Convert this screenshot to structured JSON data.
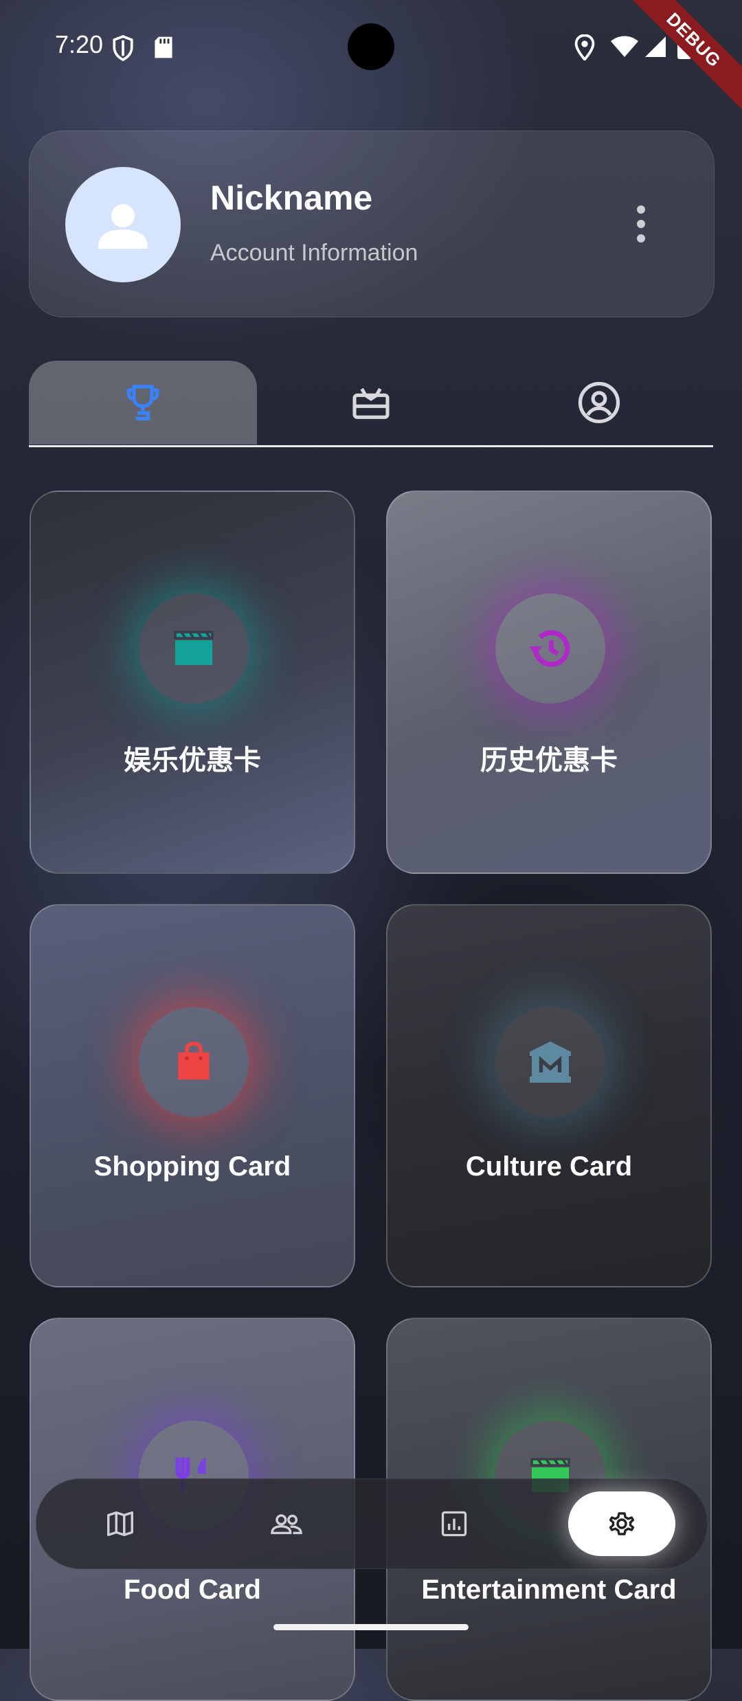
{
  "status_bar": {
    "time": "7:20",
    "debug_label": "DEBUG",
    "left_icons": [
      "shield-icon",
      "sd-card-icon"
    ],
    "right_icons": [
      "location-icon",
      "wifi-icon",
      "signal-icon",
      "battery-icon"
    ]
  },
  "profile": {
    "nickname": "Nickname",
    "subtitle": "Account Information",
    "avatar_icon": "person-icon",
    "menu_icon": "more-vert-icon"
  },
  "tabs": [
    {
      "icon": "trophy-icon",
      "active": true,
      "color": "#3b82f6"
    },
    {
      "icon": "gift-card-icon",
      "active": false
    },
    {
      "icon": "account-circle-icon",
      "active": false
    }
  ],
  "cards": [
    {
      "label": "娱乐优惠卡",
      "icon": "movie-clapper-icon",
      "color": "#14a39a"
    },
    {
      "label": "历史优惠卡",
      "icon": "history-icon",
      "color": "#b028c9"
    },
    {
      "label": "Shopping Card",
      "icon": "shopping-bag-icon",
      "color": "#ef4444"
    },
    {
      "label": "Culture Card",
      "icon": "museum-icon",
      "color": "#5d8aa0"
    },
    {
      "label": "Food Card",
      "icon": "restaurant-icon",
      "color": "#7b3fe4"
    },
    {
      "label": "Entertainment Card",
      "icon": "movie-clapper-icon",
      "color": "#34c759"
    }
  ],
  "bottom_nav": [
    {
      "icon": "map-icon",
      "active": false
    },
    {
      "icon": "group-icon",
      "active": false
    },
    {
      "icon": "analytics-icon",
      "active": false
    },
    {
      "icon": "settings-icon",
      "active": true
    }
  ]
}
